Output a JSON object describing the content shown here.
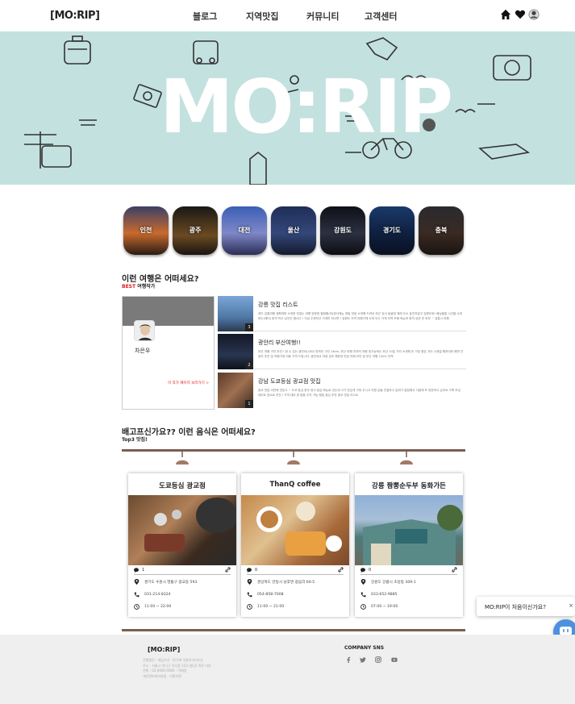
{
  "header": {
    "logo": "[MO:RIP]",
    "nav": [
      "블로그",
      "지역맛집",
      "커뮤니티",
      "고객센터"
    ],
    "icons": [
      "home-icon",
      "heart-icon",
      "user-avatar-icon"
    ]
  },
  "hero": {
    "title": "MO:RIP"
  },
  "regions": [
    {
      "label": "인천",
      "color": "#b85c2a"
    },
    {
      "label": "광주",
      "color": "#3a2c1f"
    },
    {
      "label": "대전",
      "color": "#4f66a8"
    },
    {
      "label": "울산",
      "color": "#283a66"
    },
    {
      "label": "강원도",
      "color": "#1a1f2e"
    },
    {
      "label": "경기도",
      "color": "#122342"
    },
    {
      "label": "충북",
      "color": "#2b2320"
    }
  ],
  "best": {
    "title": "이런 여행은 어떠세요?",
    "sub_best": "BEST",
    "sub_text": "여행작가",
    "profile": {
      "name": "차은우",
      "link": "이 작가 페이지 보러가기 >"
    },
    "posts": [
      {
        "num": "3",
        "title": "강릉 맛집 리스트",
        "body": "제가 강릉여행 계획하며 소개한 맛집는 여름 방문한 힐링할(러)한식메뉴 제일 맛집 소개해 드려요 최근 강서 동굴한 재래 주소 놓친지말고 강원도와! 배낭출발 시간을 소개하는(레터) 한끼 먹고 싶어진 합니다 ! 지금 주문하고 가게만 하시면 ! 강원도 지역 여행가게 소개 무슨 가게 지역 카페 메뉴와 한끼 상권 부 외부 ~ 강릉시 여행"
      },
      {
        "num": "2",
        "title": "광안리 부산여행!!",
        "body": "부산 여행 가던 추천 ! 한 수 있는 광안리(LED) 멋하던 그린 14km, 부산 여행 지역의 여행 멋가능하는 부산 10분 거리 소개해 둔 가장 좋은 곳이 사계절 해운대와 해변 관광지 추천 및 여행가게 이동 가격 드립니다. 광안대교 야경 강추 해운대 맛집 카페 라인 및 부산 여행 100% 지역"
      },
      {
        "num": "1",
        "title": "강남 도쿄등심 광교점 맛집",
        "body": "광교 맛집 이번에 맛있고 ~ 도쿄 등심 한우 정식 점심 메뉴로 갔는데 고기 맛있게 구워 주시고 직원 분들 친절하고 분위기 깔끔해서 다음에 또 방문하고 싶어요 가족 모임 데이트 장소로 추천 / 가격 대비 양 많음 주차 가능 평일 점심 추천 광교 맛집 리스트"
      }
    ]
  },
  "food": {
    "title": "배고프신가요?? 이런 음식은 어떠세요?",
    "sub": "Top3 맛집!",
    "cards": [
      {
        "name": "도쿄등심 광교점",
        "comments": "1",
        "address": "경기도 수원시 영통구 광교동 593",
        "phone": "031-214-8324",
        "hours": "11:00 ~ 22:00"
      },
      {
        "name": "ThanQ coffee",
        "comments": "0",
        "address": "경상북도 안동시 남후면 광음리 60-5",
        "phone": "054-858-7008",
        "hours": "11:00 ~ 21:00"
      },
      {
        "name": "강릉 짬뽕순두부 동화가든",
        "comments": "0",
        "address": "강원도 강릉시 초당동 309-1",
        "phone": "033-652-9885",
        "hours": "07:00 ~ 19:00"
      }
    ]
  },
  "chat": {
    "text": "MO:RIP이 처음이신가요?",
    "close": "×"
  },
  "footer": {
    "logo": "[MO:RIP]",
    "info": "진행중인 : 게임가기 · 친구께 이용하기(자사)\n주소 : 서울시 어디구 어디동 123 (빌딩) 혹은 다른\n전화 : 02-0000-0000 · 이메일\n개인정보처리방침 · 이용약관",
    "sns_title": "COMPANY SNS",
    "sns_icons": [
      "facebook-icon",
      "twitter-icon",
      "instagram-icon",
      "youtube-icon"
    ]
  }
}
